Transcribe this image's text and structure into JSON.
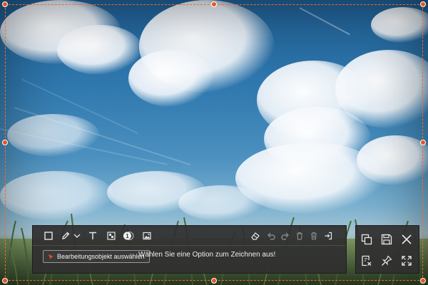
{
  "toolbar": {
    "tools": [
      {
        "icon": "rectangle-icon"
      },
      {
        "icon": "pen-icon"
      },
      {
        "icon": "chevron-down-icon"
      },
      {
        "icon": "text-icon"
      },
      {
        "icon": "mosaic-icon"
      },
      {
        "icon": "step-number-icon",
        "label": "1"
      },
      {
        "icon": "image-icon"
      },
      {
        "icon": "eraser-icon"
      },
      {
        "icon": "undo-icon"
      },
      {
        "icon": "redo-icon"
      },
      {
        "icon": "delete-icon"
      },
      {
        "icon": "clear-all-icon"
      },
      {
        "icon": "exit-icon"
      }
    ],
    "select_button_label": "Bearbeitungsobjekt auswählen",
    "hint_text": "Wählen Sie eine Option zum Zeichnen aus!"
  },
  "actions": [
    {
      "icon": "copy-icon"
    },
    {
      "icon": "save-icon"
    },
    {
      "icon": "close-icon"
    },
    {
      "icon": "save-as-icon"
    },
    {
      "icon": "pin-icon"
    },
    {
      "icon": "fullscreen-icon"
    }
  ],
  "colors": {
    "accent": "#e8541c",
    "frame_dash": "#f06a2a",
    "panel_bg": "#303030",
    "icon": "#e6e6e6"
  }
}
